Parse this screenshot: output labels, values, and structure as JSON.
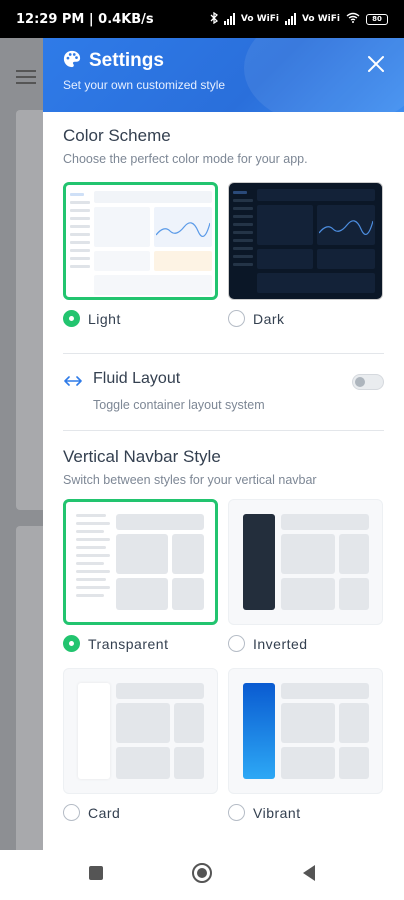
{
  "status_bar": {
    "time_speed": "12:29 PM | 0.4KB/s",
    "network_left": "Vo WiFi",
    "network_right": "Vo WiFi",
    "battery": "80"
  },
  "panel": {
    "title": "Settings",
    "subtitle": "Set your own customized style",
    "color_scheme": {
      "title": "Color Scheme",
      "description": "Choose the perfect color mode for your app.",
      "options": [
        {
          "label": "Light",
          "selected": true
        },
        {
          "label": "Dark",
          "selected": false
        }
      ]
    },
    "fluid_layout": {
      "title": "Fluid Layout",
      "description": "Toggle container layout system",
      "enabled": false
    },
    "navbar_style": {
      "title": "Vertical Navbar Style",
      "description": "Switch between styles for your vertical navbar",
      "options": [
        {
          "label": "Transparent",
          "selected": true
        },
        {
          "label": "Inverted",
          "selected": false
        },
        {
          "label": "Card",
          "selected": false
        },
        {
          "label": "Vibrant",
          "selected": false
        }
      ]
    }
  },
  "colors": {
    "accent_green": "#22c46f",
    "header_blue": "#2f7be8",
    "text_dark": "#344050",
    "text_muted": "#7d8795"
  },
  "icons": [
    "palette-icon",
    "close-icon",
    "arrows-horizontal-icon",
    "stop-icon",
    "home-icon",
    "back-icon"
  ]
}
